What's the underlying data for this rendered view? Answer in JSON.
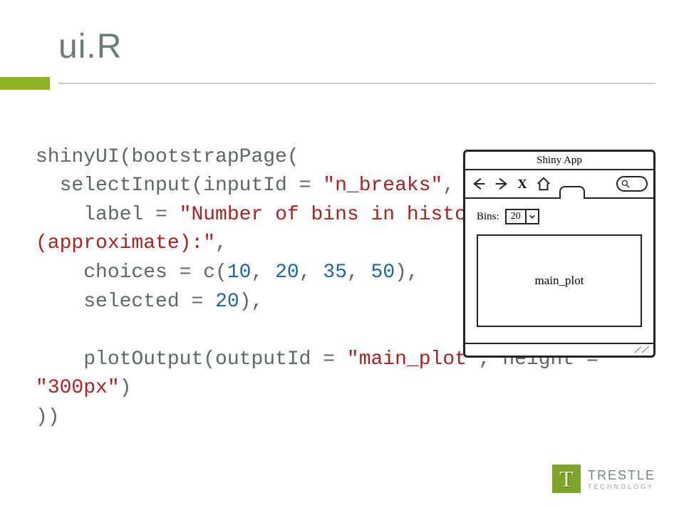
{
  "title": "ui.R",
  "code": {
    "l1": "shinyUI(bootstrapPage(",
    "l2a": "  selectInput(inputId = ",
    "l2b": "\"n_breaks\"",
    "l2c": ",",
    "l3a": "    label = ",
    "l3b": "\"Number of bins in histogram (approximate):\"",
    "l3c": ",",
    "l4a": "    choices = c(",
    "l4n1": "10",
    "l4s1": ", ",
    "l4n2": "20",
    "l4s2": ", ",
    "l4n3": "35",
    "l4s3": ", ",
    "l4n4": "50",
    "l4e": "),",
    "l5a": "    selected = ",
    "l5n": "20",
    "l5e": "),",
    "l6": "",
    "l7a": "    plotOutput(outputId = ",
    "l7b": "\"main_plot\"",
    "l7c": ", height = ",
    "l7d": "\"300px\"",
    "l7e": ")",
    "l8": "))"
  },
  "mock": {
    "window_title": "Shiny App",
    "bins_label": "Bins:",
    "bins_value": "20",
    "plot_label": "main_plot",
    "resize_glyph": "⟋⟋"
  },
  "logo": {
    "mark": "T",
    "line1": "TRESTLE",
    "line2": "TECHNOLOGY"
  }
}
